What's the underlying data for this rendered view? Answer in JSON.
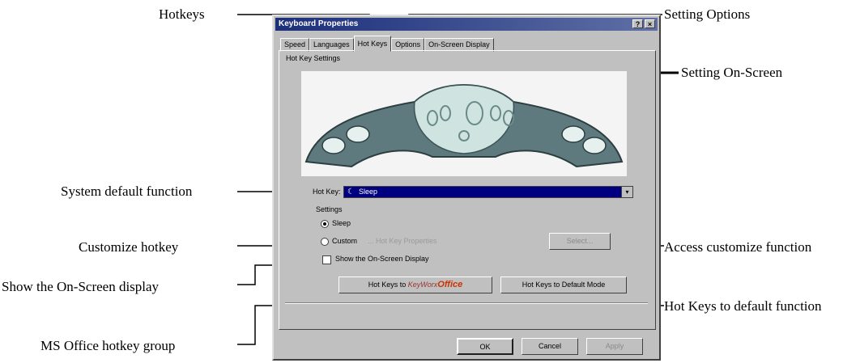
{
  "callouts": {
    "hotkeys": "Hotkeys",
    "setting_options": "Setting Options",
    "setting_on_screen": "Setting On-Screen",
    "system_default_function": "System default function",
    "customize_hotkey": "Customize hotkey",
    "access_customize_function": "Access customize function",
    "show_osd": "Show the On-Screen display",
    "hot_keys_default_function": "Hot Keys to default function",
    "ms_office_group": "MS Office hotkey group"
  },
  "dialog": {
    "title": "Keyboard Properties",
    "help_button": "?",
    "close_button": "×",
    "tabs": [
      "Speed",
      "Languages",
      "Hot Keys",
      "Options",
      "On-Screen Display"
    ],
    "active_tab": "Hot Keys",
    "group_label": "Hot Key Settings",
    "hot_key_label": "Hot Key:",
    "hot_key_value": "Sleep",
    "settings_label": "Settings",
    "radio_sleep": "Sleep",
    "radio_custom": "Custom",
    "custom_hint": "... Hot Key Properties",
    "select_button": "Select...",
    "show_osd_checkbox": "Show the On-Screen Display",
    "hotkeys_to_label": "Hot Keys to",
    "keyworx_text": "KeyWorx",
    "office_text": "Office",
    "default_mode_button": "Hot Keys to Default Mode",
    "ok_button": "OK",
    "cancel_button": "Cancel",
    "apply_button": "Apply"
  },
  "colors": {
    "titlebar": "#1c2f7a",
    "combo_selected": "#000080",
    "office_brand": "#cc3300"
  }
}
